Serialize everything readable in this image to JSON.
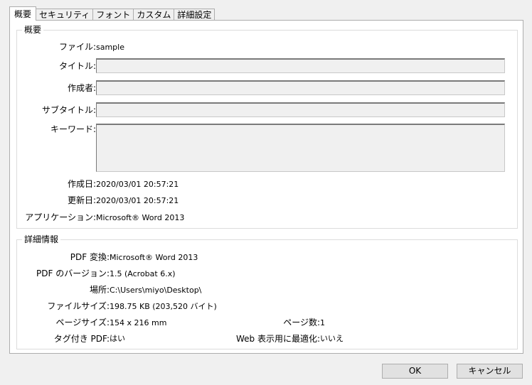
{
  "tabs": [
    "概要",
    "セキュリティ",
    "フォント",
    "カスタム",
    "詳細設定"
  ],
  "summary": {
    "title": "概要",
    "file_label": "ファイル:",
    "file_value": "sample",
    "title_label": "タイトル:",
    "title_value": "",
    "author_label": "作成者:",
    "author_value": "",
    "subtitle_label": "サブタイトル:",
    "subtitle_value": "",
    "keywords_label": "キーワード:",
    "keywords_value": "",
    "created_label": "作成日:",
    "created_value": "2020/03/01 20:57:21",
    "modified_label": "更新日:",
    "modified_value": "2020/03/01 20:57:21",
    "app_label": "アプリケーション:",
    "app_value": "Microsoft® Word 2013"
  },
  "details": {
    "title": "詳細情報",
    "pdf_conv_label": "PDF 変換:",
    "pdf_conv_value": "Microsoft® Word 2013",
    "pdf_version_label": "PDF のバージョン:",
    "pdf_version_value": "1.5 (Acrobat 6.x)",
    "location_label": "場所:",
    "location_value": "C:\\Users\\miyo\\Desktop\\",
    "filesize_label": "ファイルサイズ:",
    "filesize_value": "198.75 KB (203,520 バイト)",
    "pagesize_label": "ページサイズ:",
    "pagesize_value": "154 x 216 mm",
    "pages_label": "ページ数:",
    "pages_value": "1",
    "tagged_label": "タグ付き PDF:",
    "tagged_value": "はい",
    "webopt_label": "Web 表示用に最適化:",
    "webopt_value": "いいえ"
  },
  "buttons": {
    "ok": "OK",
    "cancel": "キャンセル"
  }
}
